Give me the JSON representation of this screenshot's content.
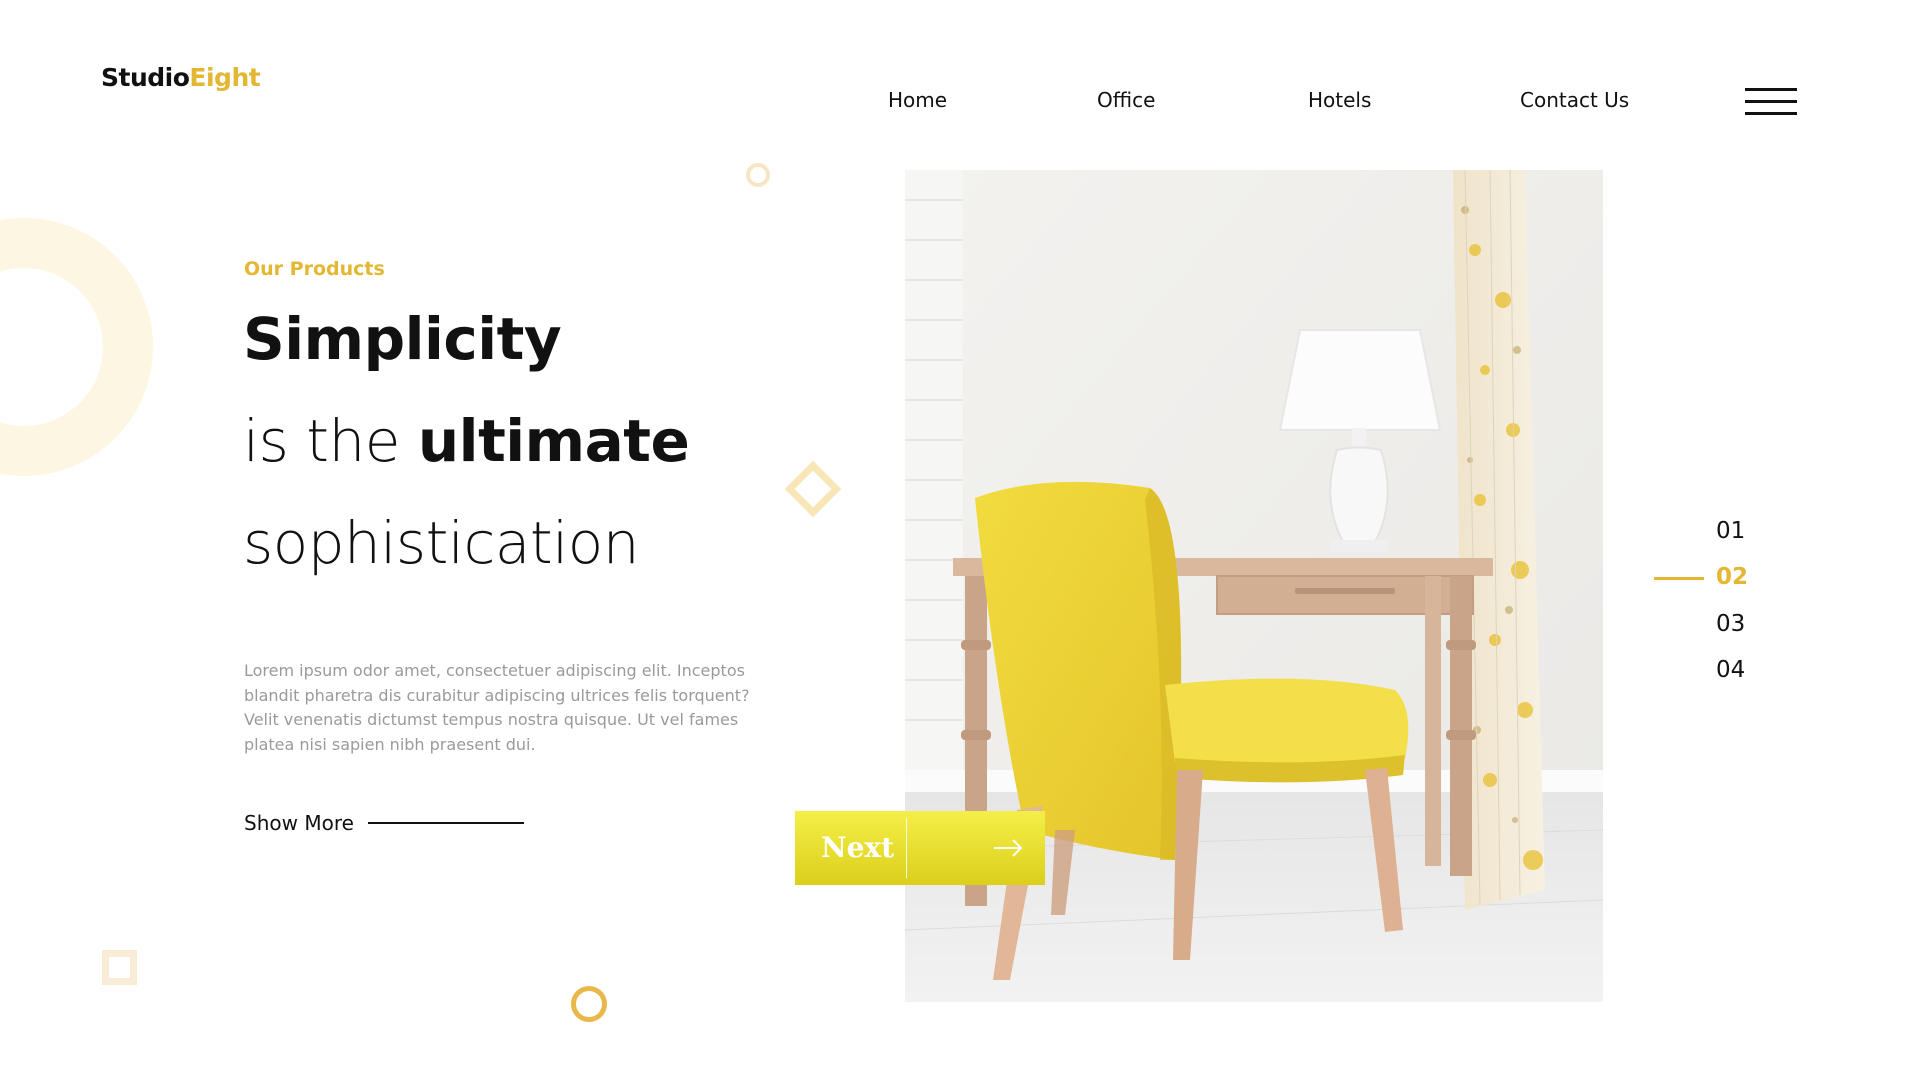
{
  "brand": {
    "name_part1": "Studio",
    "name_part2": "Eight",
    "colors": {
      "accent": "#e4b733",
      "button": "#eee63a",
      "text": "#111111",
      "muted": "#9a9a9a"
    }
  },
  "nav": {
    "items": [
      {
        "label": "Home"
      },
      {
        "label": "Office"
      },
      {
        "label": "Hotels"
      },
      {
        "label": "Contact Us"
      }
    ],
    "menu_icon": "hamburger-menu-icon"
  },
  "hero": {
    "eyebrow": "Our Products",
    "headline_line1": "Simplicity",
    "headline_line2_light": "is the ",
    "headline_line2_bold": "ultimate",
    "headline_line3": "sophistication",
    "description": "Lorem ipsum odor amet, consectetuer adipiscing elit. Inceptos blandit pharetra dis curabitur adipiscing ultrices felis torquent? Velit venenatis dictumst tempus nostra quisque. Ut vel fames platea nisi sapien nibh praesent dui.",
    "show_more_label": "Show More",
    "image_icon": "yellow-chair-desk-lamp-photo"
  },
  "slider": {
    "next_label": "Next",
    "next_icon": "arrow-right-icon",
    "pages": [
      "01",
      "02",
      "03",
      "04"
    ],
    "active_page": "02"
  }
}
